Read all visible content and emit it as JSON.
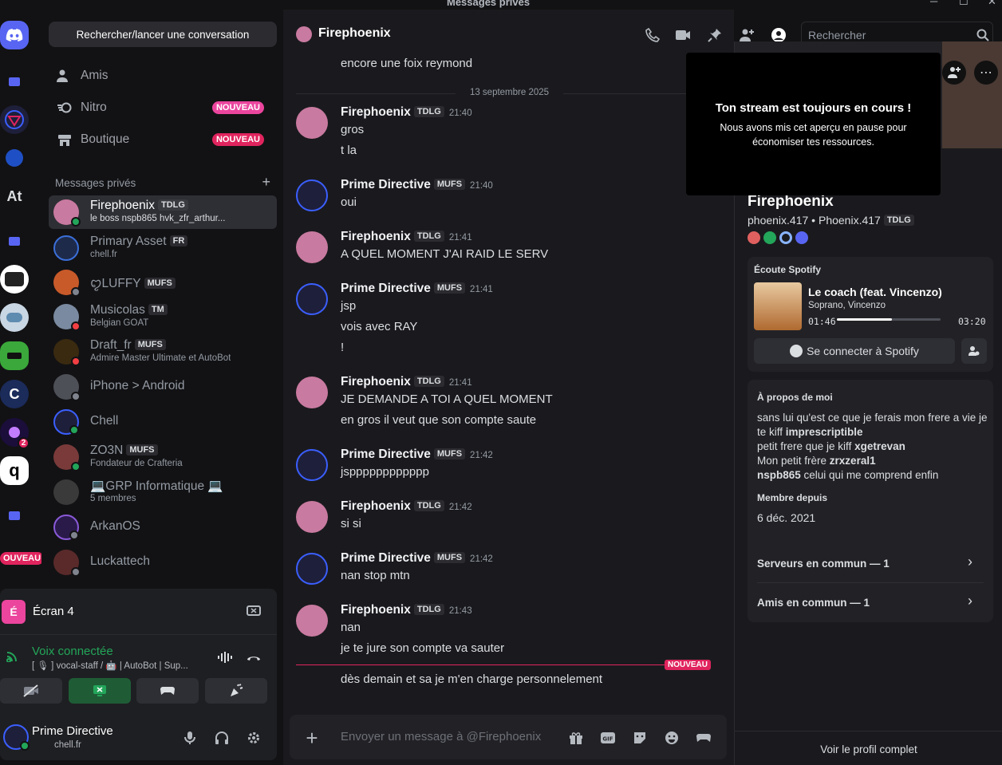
{
  "window": {
    "title": "Messages privés"
  },
  "sidebar": {
    "search_label": "Rechercher/lancer une conversation",
    "nav": [
      {
        "label": "Amis"
      },
      {
        "label": "Nitro",
        "badge": "NOUVEAU"
      },
      {
        "label": "Boutique",
        "badge": "NOUVEAU"
      }
    ],
    "dm_header": "Messages privés",
    "dms": [
      {
        "name": "Firephoenix",
        "tag": "TDLG",
        "sub": "le boss nspb865 hvk_zfr_arthur..."
      },
      {
        "name": "Primary Asset",
        "tag": "FR",
        "sub": "chell.fr"
      },
      {
        "name": "ꨄLUFFY",
        "tag": "MUFS",
        "sub": ""
      },
      {
        "name": "Musicolas",
        "tag": "TM",
        "sub": "Belgian GOAT"
      },
      {
        "name": "Draft_fr",
        "tag": "MUFS",
        "sub": "Admire Master Ultimate et AutoBot"
      },
      {
        "name": "iPhone > Android",
        "tag": "",
        "sub": ""
      },
      {
        "name": "Chell",
        "tag": "",
        "sub": ""
      },
      {
        "name": "ZO3N",
        "tag": "MUFS",
        "sub": "Fondateur de Crafteria"
      },
      {
        "name": "💻GRP Informatique 💻",
        "tag": "",
        "sub": "5 membres"
      },
      {
        "name": "ArkanOS",
        "tag": "",
        "sub": ""
      },
      {
        "name": "Luckattech",
        "tag": "",
        "sub": ""
      }
    ],
    "rail": {
      "at_label": "At",
      "new_badge": "OUVEAU",
      "mention_count": "2"
    }
  },
  "voice_panel": {
    "stream_title": "Écran 4",
    "status": "Voix connectée",
    "channel": "[ 🎙 ] vocal-staff / 🤖 | AutoBot | Sup..."
  },
  "user": {
    "name": "Prime Directive",
    "status": "chell.fr"
  },
  "chat": {
    "channel_name": "Firephoenix",
    "search_placeholder": "Rechercher",
    "composer_placeholder": "Envoyer un message à @Firephoenix",
    "top_line": "encore une foix reymond",
    "date_separator": "13 septembre 2025",
    "new_label": "NOUVEAU",
    "messages": [
      {
        "author": "Firephoenix",
        "tag": "TDLG",
        "time": "21:40",
        "lines": [
          "gros",
          "t la"
        ]
      },
      {
        "author": "Prime Directive",
        "tag": "MUFS",
        "time": "21:40",
        "lines": [
          "oui"
        ]
      },
      {
        "author": "Firephoenix",
        "tag": "TDLG",
        "time": "21:41",
        "lines": [
          "A QUEL MOMENT J'AI RAID LE SERV"
        ]
      },
      {
        "author": "Prime Directive",
        "tag": "MUFS",
        "time": "21:41",
        "lines": [
          "jsp",
          "vois avec RAY",
          "!"
        ]
      },
      {
        "author": "Firephoenix",
        "tag": "TDLG",
        "time": "21:41",
        "lines": [
          "JE DEMANDE A TOI A QUEL MOMENT",
          "en gros il veut que son compte saute"
        ]
      },
      {
        "author": "Prime Directive",
        "tag": "MUFS",
        "time": "21:42",
        "lines": [
          "jspppppppppppp"
        ]
      },
      {
        "author": "Firephoenix",
        "tag": "TDLG",
        "time": "21:42",
        "lines": [
          "si si"
        ]
      },
      {
        "author": "Prime Directive",
        "tag": "MUFS",
        "time": "21:42",
        "lines": [
          "nan stop mtn"
        ]
      },
      {
        "author": "Firephoenix",
        "tag": "TDLG",
        "time": "21:43",
        "lines": [
          "nan",
          "je te jure son compte va sauter"
        ]
      }
    ],
    "after_new": "dès demain et sa je m'en charge personnelement"
  },
  "profile": {
    "tooltip_title": "Ton stream est toujours en cours !",
    "tooltip_body": "Nous avons mis cet aperçu en pause pour économiser tes ressources.",
    "display_name": "Firephoenix",
    "username": "phoenix.417",
    "pronoun_name": "Phoenix.417",
    "tag": "TDLG",
    "spotify": {
      "header": "Écoute Spotify",
      "song": "Le coach (feat. Vincenzo)",
      "artists": "Soprano, Vincenzo",
      "elapsed": "01:46",
      "total": "03:20",
      "progress": 0.53,
      "connect_label": "Se connecter à Spotify"
    },
    "about_header": "À propos de moi",
    "about_lines": [
      {
        "plain": "sans lui qu'est ce que je ferais mon frere a vie je te kiff ",
        "bold": "imprescriptible"
      },
      {
        "plain": "petit frere que je kiff ",
        "bold": "xgetrevan"
      },
      {
        "plain": "Mon petit frère ",
        "bold": "zrxzeral1"
      },
      {
        "bold_first": "nspb865",
        "plain": " celui qui me comprend enfin"
      }
    ],
    "member_since_header": "Membre depuis",
    "member_since": "6 déc. 2021",
    "mutual_servers": "Serveurs en commun — 1",
    "mutual_friends": "Amis en commun — 1",
    "full_profile": "Voir le profil complet"
  },
  "colors": {
    "brand": "#5865f2",
    "danger": "#e0245e",
    "online": "#23a55a",
    "green_active": "#1f5c36"
  }
}
